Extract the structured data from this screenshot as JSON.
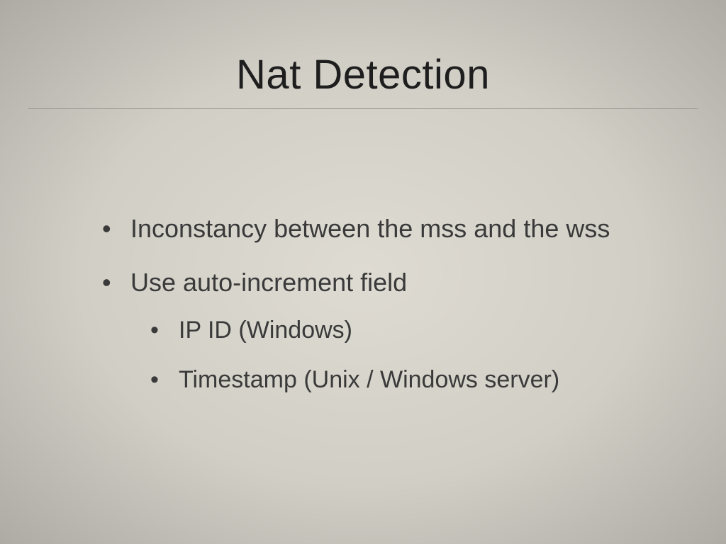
{
  "slide": {
    "title": "Nat Detection",
    "bullets": [
      {
        "text": "Inconstancy between the mss and the wss"
      },
      {
        "text": "Use auto-increment field",
        "sub": [
          {
            "text": "IP ID (Windows)"
          },
          {
            "text": "Timestamp (Unix / Windows server)"
          }
        ]
      }
    ]
  }
}
